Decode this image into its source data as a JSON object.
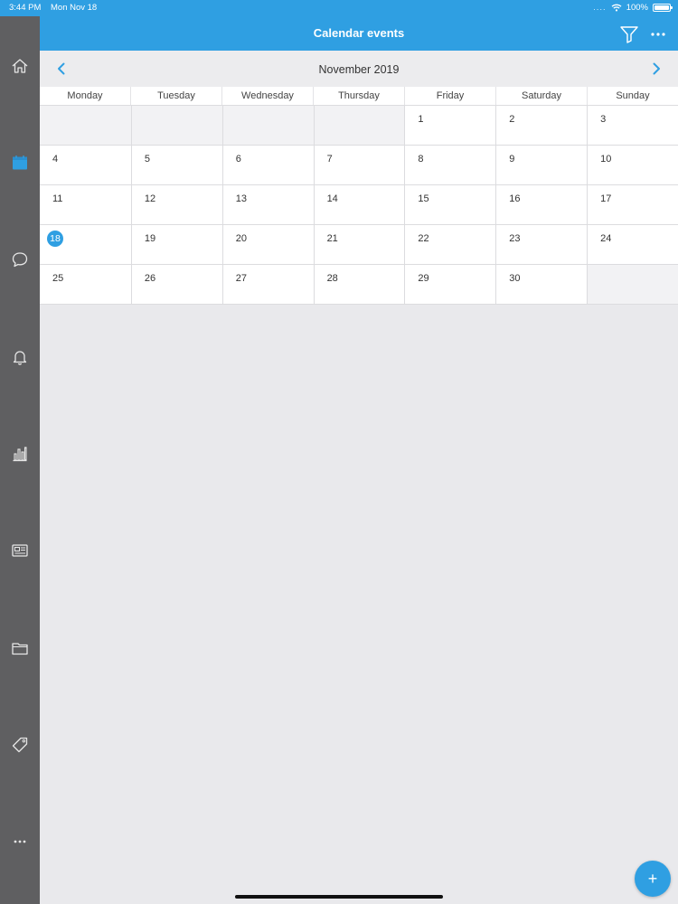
{
  "status_bar": {
    "time": "3:44 PM",
    "date": "Mon Nov 18",
    "battery": "100%",
    "dots": "...."
  },
  "header": {
    "title": "Calendar events"
  },
  "calendar": {
    "month_label": "November 2019",
    "weekdays": [
      "Monday",
      "Tuesday",
      "Wednesday",
      "Thursday",
      "Friday",
      "Saturday",
      "Sunday"
    ],
    "weeks": [
      [
        "",
        "",
        "",
        "",
        "1",
        "2",
        "3"
      ],
      [
        "4",
        "5",
        "6",
        "7",
        "8",
        "9",
        "10"
      ],
      [
        "11",
        "12",
        "13",
        "14",
        "15",
        "16",
        "17"
      ],
      [
        "18",
        "19",
        "20",
        "21",
        "22",
        "23",
        "24"
      ],
      [
        "25",
        "26",
        "27",
        "28",
        "29",
        "30",
        ""
      ]
    ],
    "today": "18"
  },
  "sidebar": {
    "items": [
      {
        "icon": "home-icon"
      },
      {
        "icon": "calendar-icon",
        "active": true
      },
      {
        "icon": "chat-icon"
      },
      {
        "icon": "bell-icon"
      },
      {
        "icon": "bar-chart-icon"
      },
      {
        "icon": "newspaper-icon"
      },
      {
        "icon": "folder-icon"
      },
      {
        "icon": "tag-icon"
      },
      {
        "icon": "more-icon"
      }
    ]
  },
  "fab": {
    "label": "+"
  },
  "colors": {
    "accent": "#2f9fe2",
    "sidebar": "#5f5f61",
    "background": "#e9e9ec"
  }
}
